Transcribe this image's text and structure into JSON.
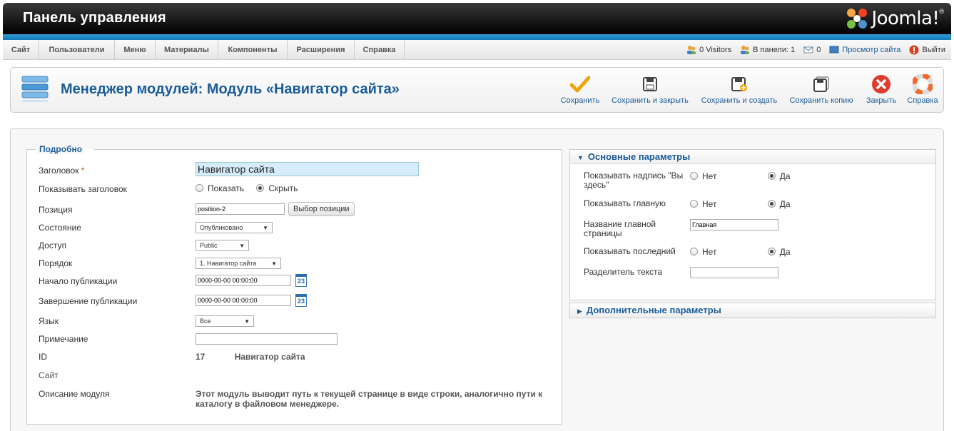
{
  "header": {
    "title": "Панель управления",
    "logo_text": "Joomla!",
    "logo_reg": "®"
  },
  "menu": [
    "Сайт",
    "Пользователи",
    "Меню",
    "Материалы",
    "Компоненты",
    "Расширения",
    "Справка"
  ],
  "status": {
    "visitors": "0 Visitors",
    "admins": "В панели: 1",
    "messages": "0",
    "view_site": "Просмотр сайта",
    "logout": "Выйти"
  },
  "toolbar": {
    "page_title": "Менеджер модулей: Модуль «Навигатор сайта»",
    "save": "Сохранить",
    "save_close": "Сохранить и закрыть",
    "save_new": "Сохранить и создать",
    "save_copy": "Сохранить копию",
    "close": "Закрыть",
    "help": "Справка"
  },
  "details": {
    "legend": "Подробно",
    "title_label": "Заголовок",
    "required_mark": "*",
    "title_value": "Навигатор сайта",
    "show_title_label": "Показывать заголовок",
    "show_opt": "Показать",
    "hide_opt": "Скрыть",
    "show_title_selected": "hide",
    "position_label": "Позиция",
    "position_value": "position-2",
    "position_button": "Выбор позиции",
    "state_label": "Состояние",
    "state_value": "Опубликовано",
    "access_label": "Доступ",
    "access_value": "Public",
    "order_label": "Порядок",
    "order_value": "1. Навигатор сайта",
    "pub_start_label": "Начало публикации",
    "pub_start_value": "0000-00-00 00:00:00",
    "pub_end_label": "Завершение публикации",
    "pub_end_value": "0000-00-00 00:00:00",
    "calendar_day": "23",
    "language_label": "Язык",
    "language_value": "Все",
    "note_label": "Примечание",
    "note_value": "",
    "id_label": "ID",
    "id_value": "17",
    "id_name": "Навигатор сайта",
    "site_label": "Сайт",
    "desc_label": "Описание модуля",
    "desc_value": "Этот модуль выводит путь к текущей странице в виде строки, аналогично пути к каталогу в файловом менеджере."
  },
  "basic": {
    "header": "Основные параметры",
    "show_here_label": "Показывать надпись \"Вы здесь\"",
    "show_home_label": "Показывать главную",
    "home_name_label": "Название главной страницы",
    "home_name_value": "Главная",
    "show_last_label": "Показывать последний",
    "separator_label": "Разделитель текста",
    "separator_value": "",
    "no_opt": "Нет",
    "yes_opt": "Да"
  },
  "advanced": {
    "header": "Дополнительные параметры"
  },
  "colors": {
    "accent_blue": "#1a5c9a",
    "bar_blue": "#1479b8",
    "save_check": "#f0a30a",
    "close_red": "#e03b2c",
    "logout_red": "#d9411e"
  }
}
